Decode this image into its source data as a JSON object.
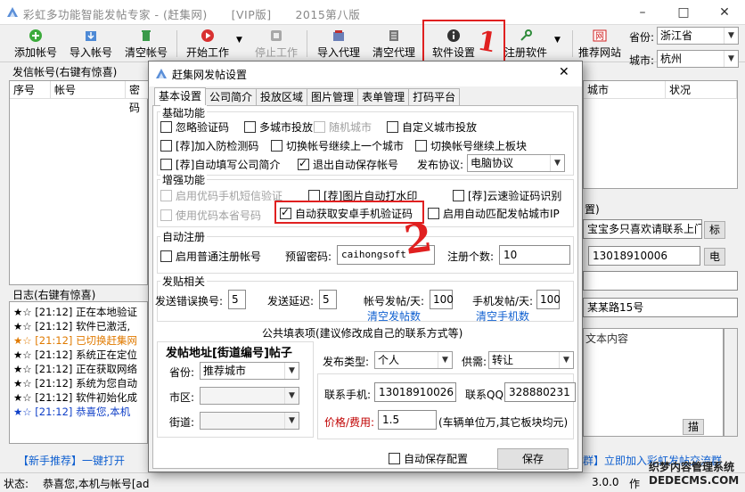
{
  "window": {
    "title_app": "彩虹多功能智能发帖专家",
    "title_site": "(赶集网)",
    "title_edition": "[VIP版]",
    "title_version": "2015第八版",
    "min": "–",
    "max": "□",
    "close": "✕"
  },
  "toolbar": {
    "add_account": "添加帐号",
    "import_account": "导入帐号",
    "clear_account": "清空帐号",
    "start_work": "开始工作",
    "stop_work": "停止工作",
    "import_proxy": "导入代理",
    "clear_proxy": "清空代理",
    "software_settings": "软件设置",
    "register_software": "注册软件",
    "promo_site": "推荐网站",
    "province_label": "省份:",
    "province_value": "浙江省",
    "city_label": "城市:",
    "city_value": "杭州"
  },
  "annotations": {
    "mark1": "1",
    "mark2": "2"
  },
  "accounts": {
    "title": "发信帐号(右键有惊喜)",
    "columns": [
      "序号",
      "帐号",
      "密码"
    ],
    "right_columns": [
      "城市",
      "状况"
    ]
  },
  "bg_right": {
    "section_tail": "置)",
    "ad_text": "宝宝多只喜欢请联系上门",
    "ad_button": "标",
    "phone_value": "13018910006",
    "phone_button": "电",
    "address_tail": "某某路15号",
    "content_placeholder": "文本内容",
    "desc_button": "描"
  },
  "log": {
    "title": "日志(右键有惊喜)",
    "lines": [
      {
        "time": "[21:12]",
        "text": "正在本地验证"
      },
      {
        "time": "[21:12]",
        "text": "软件已激活,"
      },
      {
        "time": "[21:12]",
        "text": "已切换赶集网"
      },
      {
        "time": "[21:12]",
        "text": "系统正在定位"
      },
      {
        "time": "[21:12]",
        "text": "正在获取网络"
      },
      {
        "time": "[21:12]",
        "text": "系统为您自动"
      },
      {
        "time": "[21:12]",
        "text": "软件初始化成"
      },
      {
        "time": "[21:12]",
        "text": "恭喜您,本机"
      }
    ]
  },
  "footer": {
    "left_link": "【新手推荐】一键打开",
    "right_link": "群】立即加入彩虹发帖交流群",
    "status_label": "状态:",
    "status_text": "恭喜您,本机与帐号[ad",
    "version": "3.0.0",
    "author_label": "作",
    "watermark_1": "织梦内容管理系统",
    "watermark_2": "DEDECMS.COM"
  },
  "dialog": {
    "title": "赶集网发帖设置",
    "close": "✕",
    "tabs": [
      "基本设置",
      "公司简介",
      "投放区域",
      "图片管理",
      "表单管理",
      "打码平台"
    ],
    "basic": {
      "title": "基础功能",
      "ignore_captcha": "忽略验证码",
      "multi_city": "多城市投放",
      "random_city": "随机城市",
      "custom_city": "自定义城市投放",
      "anti_detect": "[荐]加入防检测码",
      "switch_prev_city": "切换帐号继续上一个城市",
      "switch_prev_board": "切换帐号继续上板块",
      "auto_company": "[荐]自动填写公司简介",
      "auto_save_on_exit": "退出自动保存帐号",
      "protocol_label": "发布协议:",
      "protocol_value": "电脑协议"
    },
    "enhanced": {
      "title": "增强功能",
      "sms_verify": "启用优码手机短信验证",
      "watermark": "[荐]图片自动打水印",
      "cloud_captcha": "[荐]云速验证码识别",
      "local_phone": "使用优码本省号码",
      "android_code": "自动获取安卓手机验证码",
      "match_ip": "启用自动匹配发帖城市IP"
    },
    "register": {
      "title": "自动注册",
      "normal_reg": "启用普通注册帐号",
      "pwd_label": "预留密码:",
      "pwd_value": "caihongsoft",
      "count_label": "注册个数:",
      "count_value": "10"
    },
    "posting": {
      "title": "发贴相关",
      "err_switch_label": "发送错误换号:",
      "err_switch_value": "5",
      "delay_label": "发送延迟:",
      "delay_value": "5",
      "per_account_label": "帐号发帖/天:",
      "per_account_value": "100",
      "per_phone_label": "手机发帖/天:",
      "per_phone_value": "100",
      "clear_posts": "清空发帖数",
      "clear_phones": "清空手机数"
    },
    "common": {
      "title": "公共填表项(建议修改成自己的联系方式等)",
      "address_title": "发帖地址[街道编号]帖子",
      "province_label": "省份:",
      "province_value": "推荐城市",
      "district_label": "市区:",
      "street_label": "街道:",
      "post_type_label": "发布类型:",
      "post_type_value": "个人",
      "supply_label": "供需:",
      "supply_value": "转让",
      "phone_label": "联系手机:",
      "phone_value": "13018910026",
      "qq_label": "联系QQ:",
      "qq_value": "328880231",
      "price_label": "价格/费用:",
      "price_value": "1.5",
      "price_note": "(车辆单位万,其它板块均元)"
    },
    "auto_save_config": "自动保存配置",
    "save": "保存"
  },
  "colors": {
    "red": "#e02020",
    "link": "#1060d0",
    "price": "#c00000"
  }
}
